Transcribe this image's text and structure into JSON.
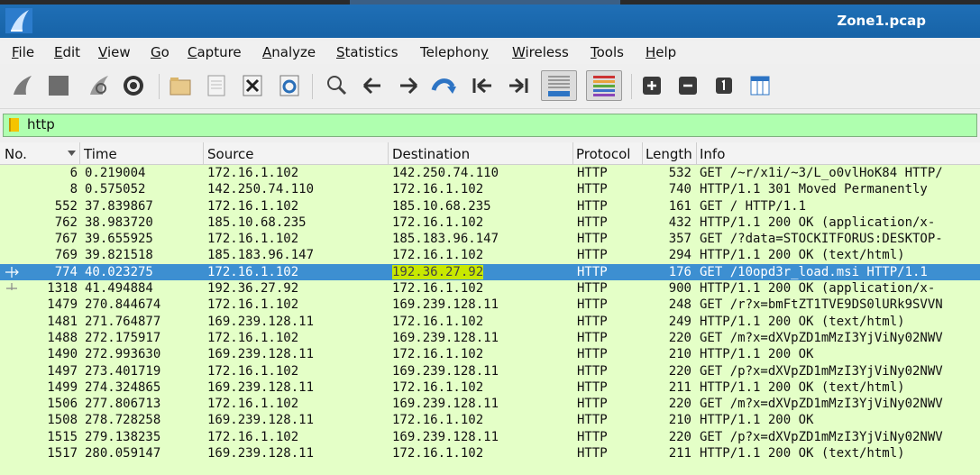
{
  "window": {
    "title": "Zone1.pcap"
  },
  "menu": [
    {
      "pre": "",
      "u": "F",
      "post": "ile"
    },
    {
      "pre": "",
      "u": "E",
      "post": "dit"
    },
    {
      "pre": "",
      "u": "V",
      "post": "iew"
    },
    {
      "pre": "",
      "u": "G",
      "post": "o"
    },
    {
      "pre": "",
      "u": "C",
      "post": "apture"
    },
    {
      "pre": "",
      "u": "A",
      "post": "nalyze"
    },
    {
      "pre": "",
      "u": "S",
      "post": "tatistics"
    },
    {
      "pre": "Telephon",
      "u": "y",
      "post": ""
    },
    {
      "pre": "",
      "u": "W",
      "post": "ireless"
    },
    {
      "pre": "",
      "u": "T",
      "post": "ools"
    },
    {
      "pre": "",
      "u": "H",
      "post": "elp"
    }
  ],
  "filter": {
    "value": "http"
  },
  "columns": {
    "no": "No.",
    "time": "Time",
    "source": "Source",
    "destination": "Destination",
    "protocol": "Protocol",
    "length": "Length",
    "info": "Info"
  },
  "packets": [
    {
      "no": "6",
      "time": "0.219004",
      "src": "172.16.1.102",
      "dst": "142.250.74.110",
      "proto": "HTTP",
      "len": "532",
      "info": "GET /~r/x1i/~3/L_o0vlHoK84 HTTP/"
    },
    {
      "no": "8",
      "time": "0.575052",
      "src": "142.250.74.110",
      "dst": "172.16.1.102",
      "proto": "HTTP",
      "len": "740",
      "info": "HTTP/1.1 301 Moved Permanently"
    },
    {
      "no": "552",
      "time": "37.839867",
      "src": "172.16.1.102",
      "dst": "185.10.68.235",
      "proto": "HTTP",
      "len": "161",
      "info": "GET / HTTP/1.1"
    },
    {
      "no": "762",
      "time": "38.983720",
      "src": "185.10.68.235",
      "dst": "172.16.1.102",
      "proto": "HTTP",
      "len": "432",
      "info": "HTTP/1.1 200 OK  (application/x-"
    },
    {
      "no": "767",
      "time": "39.655925",
      "src": "172.16.1.102",
      "dst": "185.183.96.147",
      "proto": "HTTP",
      "len": "357",
      "info": "GET /?data=STOCKITFORUS:DESKTOP-"
    },
    {
      "no": "769",
      "time": "39.821518",
      "src": "185.183.96.147",
      "dst": "172.16.1.102",
      "proto": "HTTP",
      "len": "294",
      "info": "HTTP/1.1 200 OK  (text/html)"
    },
    {
      "no": "774",
      "time": "40.023275",
      "src": "172.16.1.102",
      "dst": "192.36.27.92",
      "proto": "HTTP",
      "len": "176",
      "info": "GET /10opd3r_load.msi HTTP/1.1"
    },
    {
      "no": "1318",
      "time": "41.494884",
      "src": "192.36.27.92",
      "dst": "172.16.1.102",
      "proto": "HTTP",
      "len": "900",
      "info": "HTTP/1.1 200 OK  (application/x-"
    },
    {
      "no": "1479",
      "time": "270.844674",
      "src": "172.16.1.102",
      "dst": "169.239.128.11",
      "proto": "HTTP",
      "len": "248",
      "info": "GET /r?x=bmFtZT1TVE9DS0lURk9SVVN"
    },
    {
      "no": "1481",
      "time": "271.764877",
      "src": "169.239.128.11",
      "dst": "172.16.1.102",
      "proto": "HTTP",
      "len": "249",
      "info": "HTTP/1.1 200 OK  (text/html)"
    },
    {
      "no": "1488",
      "time": "272.175917",
      "src": "172.16.1.102",
      "dst": "169.239.128.11",
      "proto": "HTTP",
      "len": "220",
      "info": "GET /m?x=dXVpZD1mMzI3YjViNy02NWV"
    },
    {
      "no": "1490",
      "time": "272.993630",
      "src": "169.239.128.11",
      "dst": "172.16.1.102",
      "proto": "HTTP",
      "len": "210",
      "info": "HTTP/1.1 200 OK"
    },
    {
      "no": "1497",
      "time": "273.401719",
      "src": "172.16.1.102",
      "dst": "169.239.128.11",
      "proto": "HTTP",
      "len": "220",
      "info": "GET /p?x=dXVpZD1mMzI3YjViNy02NWV"
    },
    {
      "no": "1499",
      "time": "274.324865",
      "src": "169.239.128.11",
      "dst": "172.16.1.102",
      "proto": "HTTP",
      "len": "211",
      "info": "HTTP/1.1 200 OK  (text/html)"
    },
    {
      "no": "1506",
      "time": "277.806713",
      "src": "172.16.1.102",
      "dst": "169.239.128.11",
      "proto": "HTTP",
      "len": "220",
      "info": "GET /m?x=dXVpZD1mMzI3YjViNy02NWV"
    },
    {
      "no": "1508",
      "time": "278.728258",
      "src": "169.239.128.11",
      "dst": "172.16.1.102",
      "proto": "HTTP",
      "len": "210",
      "info": "HTTP/1.1 200 OK"
    },
    {
      "no": "1515",
      "time": "279.138235",
      "src": "172.16.1.102",
      "dst": "169.239.128.11",
      "proto": "HTTP",
      "len": "220",
      "info": "GET /p?x=dXVpZD1mMzI3YjViNy02NWV"
    },
    {
      "no": "1517",
      "time": "280.059147",
      "src": "169.239.128.11",
      "dst": "172.16.1.102",
      "proto": "HTTP",
      "len": "211",
      "info": "HTTP/1.1 200 OK  (text/html)"
    }
  ],
  "selected_packet": "774",
  "highlight": {
    "selected_destination_color": "#c8e800",
    "selected_row_color": "#3d8fd1",
    "http_row_color": "#e4ffc7",
    "filter_ok_color": "#afffaf"
  },
  "toolbar_icons": [
    "shark-fin-start-icon",
    "stop-capture-icon",
    "restart-capture-icon",
    "capture-options-icon",
    "open-file-icon",
    "save-file-icon",
    "close-file-icon",
    "reload-file-icon",
    "find-packet-icon",
    "go-back-icon",
    "go-forward-icon",
    "go-to-packet-icon",
    "first-packet-icon",
    "last-packet-icon",
    "auto-scroll-icon",
    "colorize-icon",
    "zoom-in-icon",
    "zoom-out-icon",
    "normal-size-icon",
    "resize-columns-icon"
  ]
}
